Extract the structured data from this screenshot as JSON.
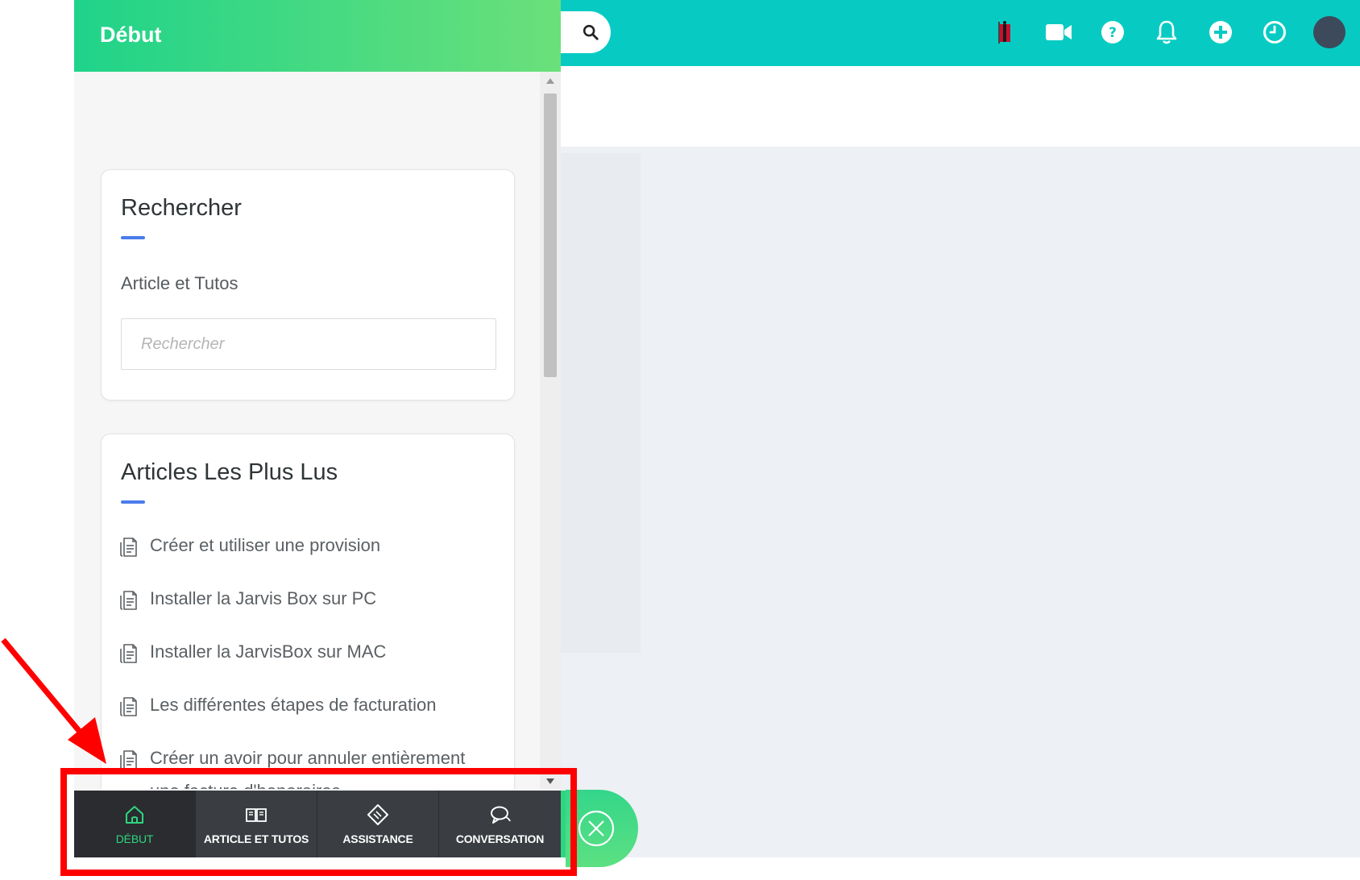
{
  "widget": {
    "header_title": "Début",
    "search_card": {
      "title": "Rechercher",
      "section_label": "Article et Tutos",
      "input_value": "",
      "input_placeholder": "Rechercher"
    },
    "articles_card": {
      "title": "Articles Les Plus Lus",
      "items": [
        {
          "label": "Créer et utiliser une provision"
        },
        {
          "label": "Installer la Jarvis Box sur PC"
        },
        {
          "label": "Installer la JarvisBox sur MAC"
        },
        {
          "label": "Les différentes étapes de facturation"
        },
        {
          "label": "Créer un avoir pour annuler entièrement une facture d'honoraires"
        }
      ]
    },
    "bottom_nav": [
      {
        "label": "DÉBUT",
        "icon": "home-icon",
        "active": true
      },
      {
        "label": "ARTICLE ET TUTOS",
        "icon": "book-icon",
        "active": false
      },
      {
        "label": "ASSISTANCE",
        "icon": "ticket-icon",
        "active": false
      },
      {
        "label": "CONVERSATION",
        "icon": "chat-icon",
        "active": false
      }
    ],
    "launcher_icon": "close-icon"
  },
  "topbar": {
    "icons": [
      "search-icon",
      "flag-icon",
      "video-icon",
      "help-icon",
      "bell-icon",
      "plus-icon",
      "clock-icon",
      "avatar"
    ]
  },
  "colors": {
    "topbar": "#07cbc3",
    "header_gradient_start": "#1fd38a",
    "header_gradient_end": "#6be07a",
    "accent_blue": "#4b7bec",
    "nav_active_text": "#2fd580",
    "nav_background": "#3a3d42",
    "annotation_red": "#ff0000"
  }
}
